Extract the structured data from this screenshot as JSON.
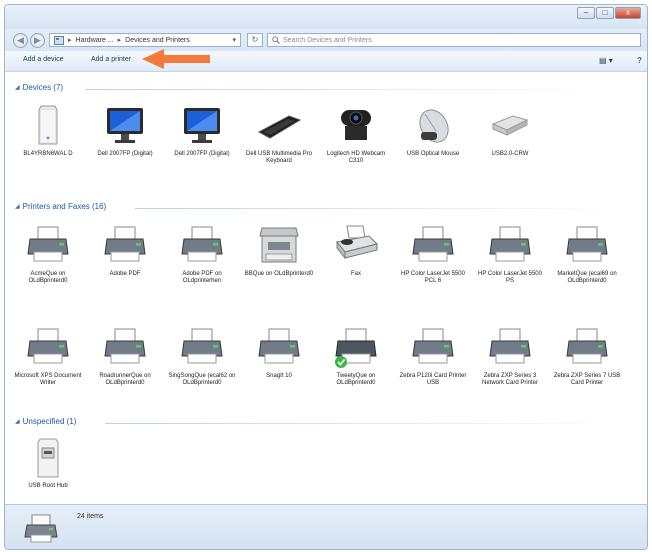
{
  "window": {
    "caption_buttons": {
      "minimize": "–",
      "maximize": "□",
      "close": "x"
    }
  },
  "nav": {
    "back_glyph": "◀",
    "forward_glyph": "▶",
    "breadcrumb": [
      "Hardware ...",
      "Devices and Printers"
    ],
    "breadcrumb_sep": "▸",
    "dropdown_glyph": "▾",
    "refresh_glyph": "↻",
    "search_placeholder": "Search Devices and Printers",
    "search_icon": "search-icon"
  },
  "toolbar": {
    "add_device": "Add a device",
    "add_printer": "Add a printer",
    "view_glyph": "▤ ▾",
    "help_glyph": "?"
  },
  "accent_colors": {
    "arrow": "#f4793b",
    "group_header": "#1e5aa8"
  },
  "groups": {
    "devices": {
      "label": "Devices (7)",
      "tri": "◢"
    },
    "printers": {
      "label": "Printers and Faxes (16)",
      "tri": "◢"
    },
    "unspecified": {
      "label": "Unspecified (1)",
      "tri": "◢"
    }
  },
  "devices": [
    {
      "label": "BL4YRBN6WAL D",
      "icon": "computer-tower-icon"
    },
    {
      "label": "Dell 2007FP (Digital)",
      "icon": "monitor-icon"
    },
    {
      "label": "Dell 2007FP (Digital)",
      "icon": "monitor-icon"
    },
    {
      "label": "Dell USB Multimedia Pro Keyboard",
      "icon": "keyboard-icon"
    },
    {
      "label": "Logitech HD Webcam C310",
      "icon": "webcam-icon"
    },
    {
      "label": "USB Optical Mouse",
      "icon": "mouse-icon"
    },
    {
      "label": "USB2.0-CRW",
      "icon": "card-reader-icon"
    }
  ],
  "printers_row1": [
    {
      "label": "AcmeQue on OLdBprinterd0",
      "icon": "printer-icon"
    },
    {
      "label": "Adobe PDF",
      "icon": "printer-icon"
    },
    {
      "label": "Adobe PDF on OLdprinterhen",
      "icon": "printer-icon"
    },
    {
      "label": "BBQue on OLdBprinterd0",
      "icon": "multifunction-printer-icon"
    },
    {
      "label": "Fax",
      "icon": "fax-icon"
    },
    {
      "label": "HP Color LaserJet 5500 PCL 6",
      "icon": "printer-icon"
    },
    {
      "label": "HP Color LaserJet 5500 PS",
      "icon": "printer-icon"
    },
    {
      "label": "MarketQue (ecal69 on OLdBprinterd0",
      "icon": "printer-icon"
    }
  ],
  "printers_row2": [
    {
      "label": "Microsoft XPS Document Writer",
      "icon": "printer-icon"
    },
    {
      "label": "RoadrunnerQue on OLdBprinterd0",
      "icon": "printer-icon"
    },
    {
      "label": "SingSongQue (ecal62 on OLdBprinterd0",
      "icon": "printer-icon"
    },
    {
      "label": "SnagIt 10",
      "icon": "printer-icon"
    },
    {
      "label": "TweetyQue on OLdBprinterd0",
      "icon": "default-printer-icon"
    },
    {
      "label": "Zebra P120i Card Printer USB",
      "icon": "printer-icon"
    },
    {
      "label": "Zebra ZXP Series 3 Network Card Printer",
      "icon": "printer-icon"
    },
    {
      "label": "Zebra ZXP Series 7 USB Card Printer",
      "icon": "printer-icon"
    }
  ],
  "unspecified": [
    {
      "label": "USB Root Hub",
      "icon": "usb-hub-icon"
    }
  ],
  "status": {
    "count": "24 items",
    "icon": "printer-icon"
  }
}
